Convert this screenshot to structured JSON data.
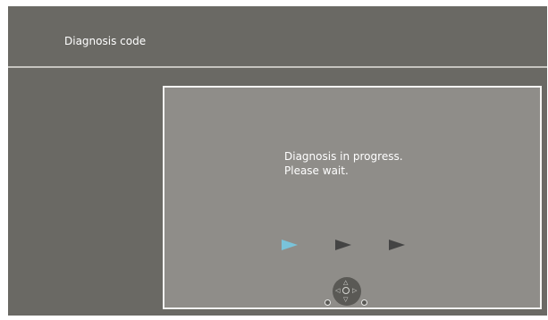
{
  "header": {
    "title": "Diagnosis code"
  },
  "panel": {
    "message_line1": "Diagnosis in progress.",
    "message_line2": "Please wait.",
    "progress": {
      "steps_total": 3,
      "active_step": 1
    }
  },
  "colors": {
    "background": "#6a6964",
    "panel": "#8f8d89",
    "panel_border": "#f4f4f2",
    "active_arrow": "#79c3da",
    "inactive_arrow": "#444444"
  },
  "controls": {
    "dpad_icon": "dpad-icon",
    "up_glyph": "△",
    "down_glyph": "▽",
    "left_glyph": "◁",
    "right_glyph": "▷"
  }
}
